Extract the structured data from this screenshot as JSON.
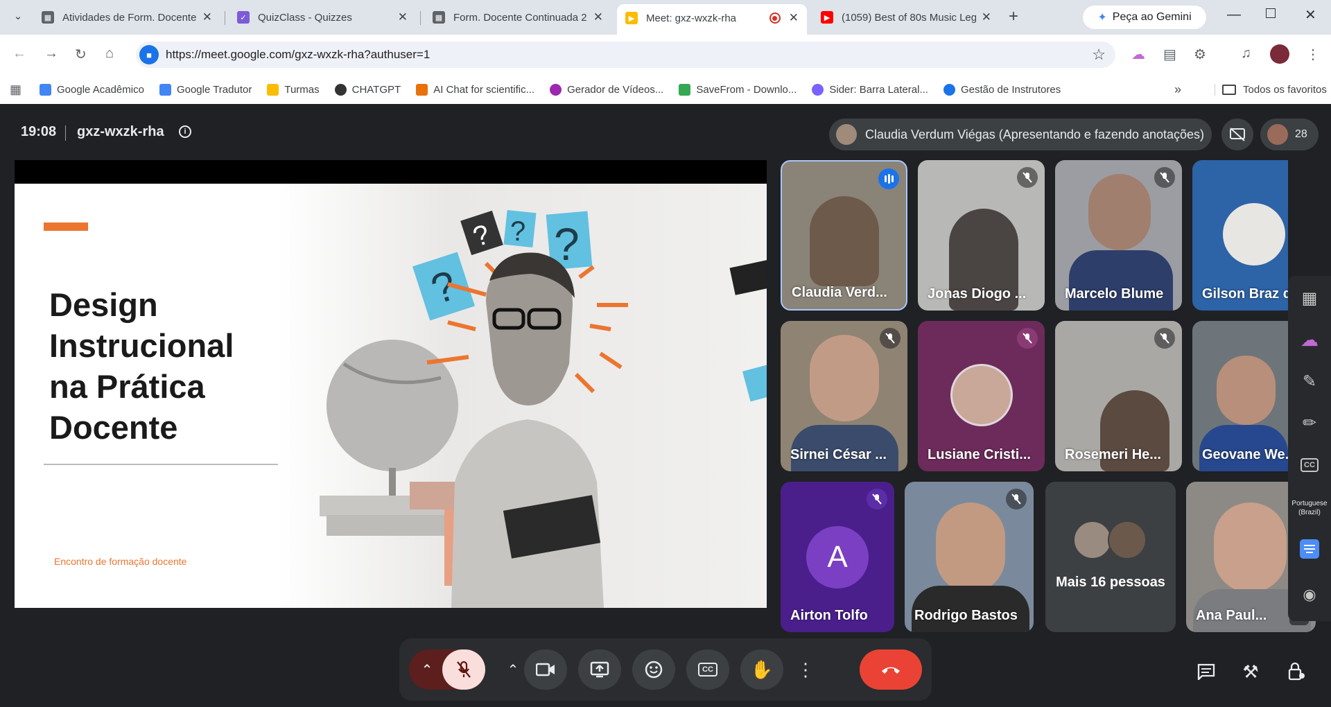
{
  "tabs": [
    {
      "title": "Atividades de Form. Docente",
      "color": "#5f6368"
    },
    {
      "title": "QuizClass - Quizzes",
      "color": "#7c5cd6"
    },
    {
      "title": "Form. Docente Continuada 2",
      "color": "#5f6368"
    },
    {
      "title": "Meet: gxz-wxzk-rha",
      "color": "#fbbc04"
    },
    {
      "title": "(1059) Best of 80s Music Leg",
      "color": "#ff0000"
    }
  ],
  "gemini_button": "Peça ao Gemini",
  "url": "https://meet.google.com/gxz-wxzk-rha?authuser=1",
  "bookmarks": [
    {
      "label": "Google Acadêmico",
      "color": "#4285f4"
    },
    {
      "label": "Google Tradutor",
      "color": "#4285f4"
    },
    {
      "label": "Turmas",
      "color": "#fbbc04"
    },
    {
      "label": "CHATGPT",
      "color": "#333333"
    },
    {
      "label": "AI Chat for scientific...",
      "color": "#e8710a"
    },
    {
      "label": "Gerador de Vídeos...",
      "color": "#9c27b0"
    },
    {
      "label": "SaveFrom - Downlo...",
      "color": "#34a853"
    },
    {
      "label": "Sider: Barra Lateral...",
      "color": "#7b61ff"
    },
    {
      "label": "Gestão de Instrutores",
      "color": "#1a73e8"
    }
  ],
  "all_bookmarks": "Todos os favoritos",
  "meet": {
    "time": "19:08",
    "code": "gxz-wxzk-rha",
    "presenter": "Claudia Verdum Viégas (Apresentando e fazendo anotações)",
    "participants_count": "28",
    "slide": {
      "title_lines": [
        "Design",
        "Instrucional",
        "na Prática",
        "Docente"
      ],
      "footer": "Encontro de formação docente"
    },
    "tiles": [
      {
        "name": "Claudia Verd...",
        "bg": "#8a8378",
        "muted": false,
        "speaking": true
      },
      {
        "name": "Jonas Diogo ...",
        "bg": "#b8b9b6",
        "muted": true
      },
      {
        "name": "Marcelo Blume",
        "bg": "#9c9da2",
        "muted": true
      },
      {
        "name": "Gilson Braz d...",
        "bg": "#2d63a7",
        "muted": false
      },
      {
        "name": "Sirnei César ...",
        "bg": "#8f8373",
        "muted": true
      },
      {
        "name": "Lusiane Cristi...",
        "bg": "#6c2b5a",
        "muted": true
      },
      {
        "name": "Rosemeri He...",
        "bg": "#a9a8a4",
        "muted": true
      },
      {
        "name": "Geovane We...",
        "bg": "#6d757a",
        "muted": false
      },
      {
        "name": "Airton Tolfo",
        "bg": "#4a1f8c",
        "muted": true,
        "initial": "A"
      },
      {
        "name": "Rodrigo Bastos",
        "bg": "#7a8a9c",
        "muted": true
      },
      {
        "name": "Mais 16 pessoas",
        "bg": "#3c4043",
        "muted": false
      },
      {
        "name": "Ana Paul...",
        "bg": "#8d8a86",
        "muted": false
      }
    ],
    "caption_lang": "Portuguese (Brazil)"
  }
}
